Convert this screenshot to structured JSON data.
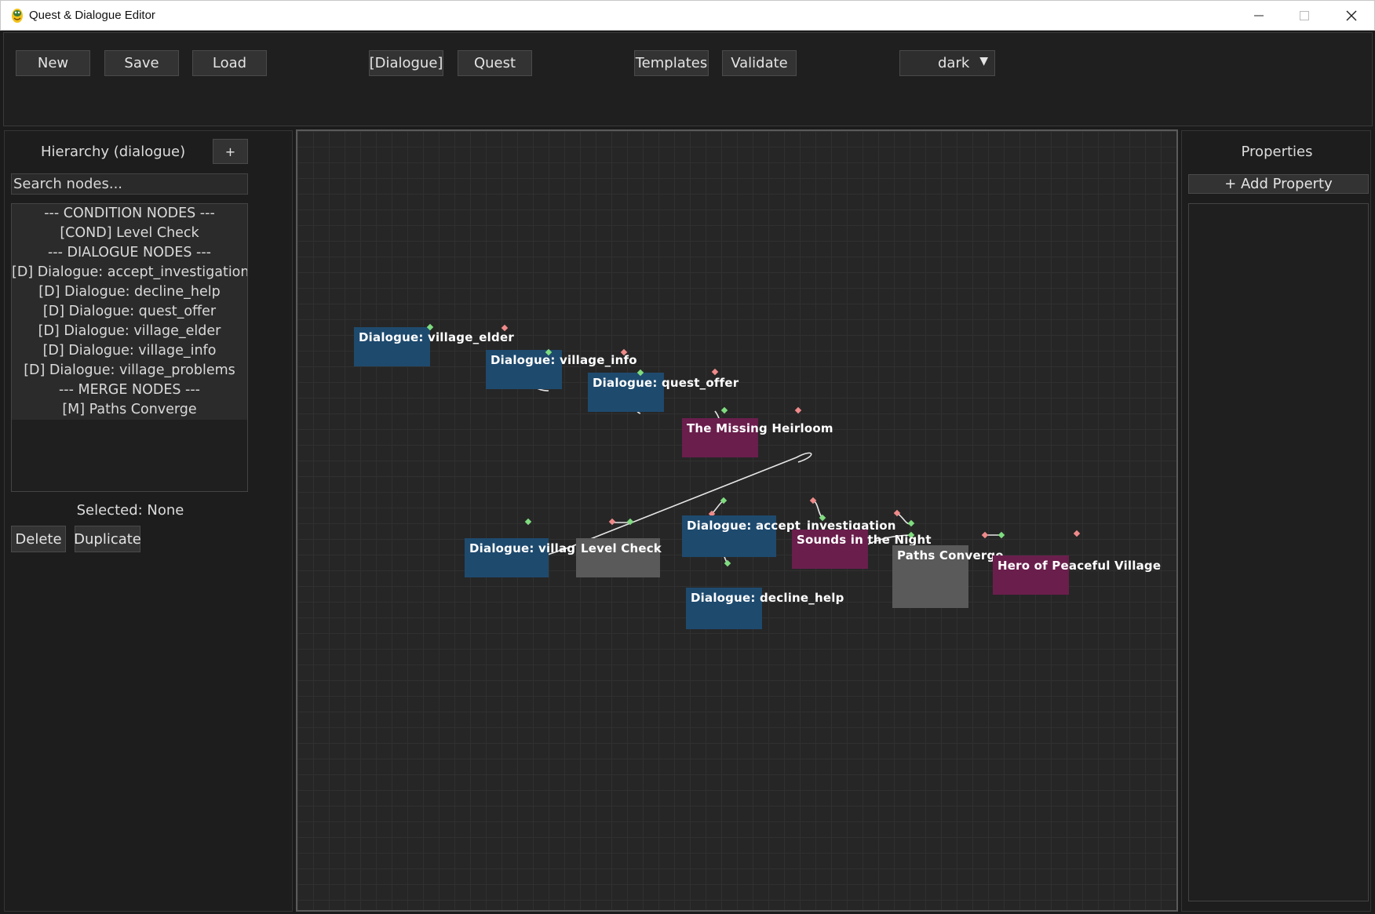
{
  "window": {
    "title": "Quest & Dialogue Editor"
  },
  "toolbar": {
    "new_label": "New",
    "save_label": "Save",
    "load_label": "Load",
    "dialogue_tab_label": "[Dialogue]",
    "quest_tab_label": "Quest",
    "templates_label": "Templates",
    "validate_label": "Validate",
    "theme_value": "dark"
  },
  "hierarchy": {
    "title": "Hierarchy (dialogue)",
    "add_label": "+",
    "search_placeholder": "Search nodes...",
    "items": [
      "--- CONDITION NODES ---",
      "[COND] Level Check",
      "--- DIALOGUE NODES ---",
      "[D] Dialogue: accept_investigation",
      "[D] Dialogue: decline_help",
      "[D] Dialogue: quest_offer",
      "[D] Dialogue: village_elder",
      "[D] Dialogue: village_info",
      "[D] Dialogue: village_problems",
      "--- MERGE NODES ---",
      "[M] Paths Converge"
    ],
    "selected_label": "Selected: None",
    "delete_label": "Delete",
    "duplicate_label": "Duplicate"
  },
  "canvas": {
    "nodes": [
      {
        "id": "village_elder",
        "title": "Dialogue: village_elder",
        "kind": "dialogue"
      },
      {
        "id": "village_info",
        "title": "Dialogue: village_info",
        "kind": "dialogue"
      },
      {
        "id": "quest_offer",
        "title": "Dialogue: quest_offer",
        "kind": "dialogue"
      },
      {
        "id": "missing_heirloom",
        "title": "The Missing Heirloom",
        "kind": "quest"
      },
      {
        "id": "village_problems",
        "title": "Dialogue: village_p",
        "kind": "dialogue"
      },
      {
        "id": "level_check",
        "title": "Level Check",
        "kind": "cond"
      },
      {
        "id": "accept_investigation",
        "title": "Dialogue: accept_investigation",
        "kind": "dialogue"
      },
      {
        "id": "sounds_night",
        "title": "Sounds in the Night",
        "kind": "quest"
      },
      {
        "id": "decline_help",
        "title": "Dialogue: decline_help",
        "kind": "dialogue"
      },
      {
        "id": "paths_converge",
        "title": "Paths Converge",
        "kind": "merge"
      },
      {
        "id": "hero_village",
        "title": "Hero of Peaceful Village",
        "kind": "quest"
      }
    ],
    "colors": {
      "dialogue": "#1e4a6e",
      "quest": "#6a1e4c",
      "condition": "#5a5a5a",
      "merge": "#5a5a5a",
      "link": "#e6e6e6",
      "input_port": "#7fdc7f",
      "output_port": "#f08a8a"
    }
  },
  "properties": {
    "title": "Properties",
    "add_label": "+ Add Property"
  }
}
